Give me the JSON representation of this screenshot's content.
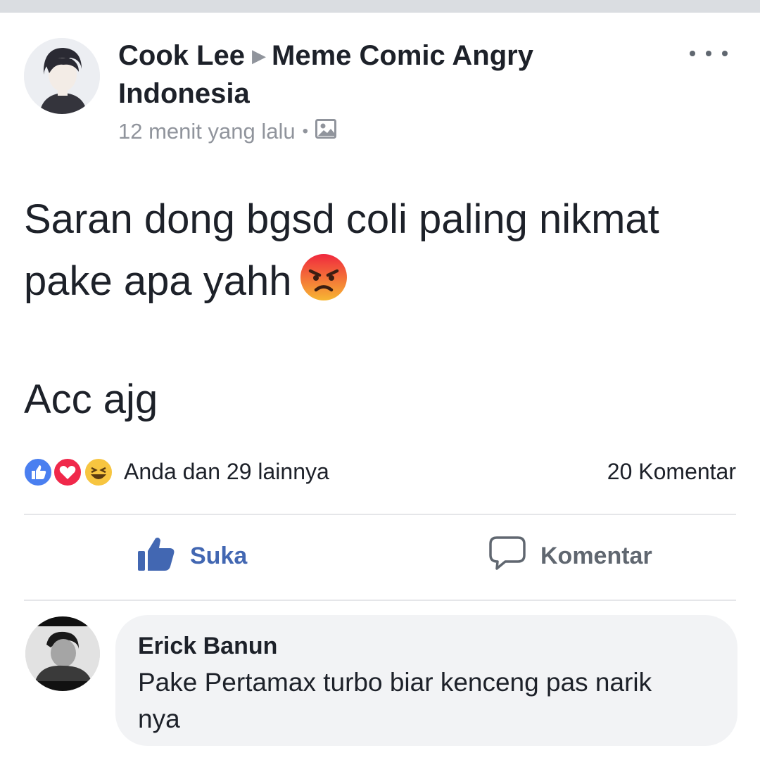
{
  "post": {
    "author": "Cook Lee",
    "arrow": "▶",
    "group": "Meme Comic Angry Indonesia",
    "time": "12 menit yang lalu",
    "separator": "•",
    "audience_icon": "photo-album-icon",
    "text_line1": "Saran dong bgsd coli paling nikmat",
    "text_line2": "pake apa yahh",
    "text_emoji": "angry-face-icon",
    "text_line3": "Acc ajg"
  },
  "reactions": {
    "icons": [
      "like-reaction-icon",
      "love-reaction-icon",
      "haha-reaction-icon"
    ],
    "summary": "Anda dan 29 lainnya",
    "comments": "20 Komentar"
  },
  "actions": {
    "like_label": "Suka",
    "comment_label": "Komentar"
  },
  "comment": {
    "author": "Erick Banun",
    "text": "Pake Pertamax turbo biar kenceng pas narik nya"
  },
  "colors": {
    "brand_blue": "#4267b2",
    "muted_text": "#90949c",
    "bubble_bg": "#f2f3f5",
    "love_red": "#f0284a",
    "haha_yellow": "#f7c540"
  }
}
